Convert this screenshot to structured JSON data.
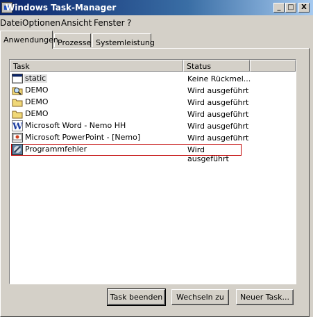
{
  "window": {
    "title": "Windows Task-Manager"
  },
  "titlebar_buttons": {
    "minimize": "_",
    "maximize": "□",
    "close": "X"
  },
  "menu": [
    "Datei",
    "Optionen",
    "Ansicht",
    "Fenster",
    "?"
  ],
  "tabs": [
    "Anwendungen",
    "Prozesse",
    "Systemleistung"
  ],
  "list": {
    "headers": {
      "task": "Task",
      "status": "Status"
    },
    "rows": [
      {
        "icon": "application-window-icon",
        "task": "static",
        "status": "Keine Rückmel..."
      },
      {
        "icon": "folder-search-icon",
        "task": "DEMO",
        "status": "Wird ausgeführt"
      },
      {
        "icon": "folder-icon",
        "task": "DEMO",
        "status": "Wird ausgeführt"
      },
      {
        "icon": "folder-icon",
        "task": "DEMO",
        "status": "Wird ausgeführt"
      },
      {
        "icon": "word-icon",
        "task": "Microsoft Word - Nemo HH",
        "status": "Wird ausgeführt"
      },
      {
        "icon": "powerpoint-icon",
        "task": "Microsoft PowerPoint - [Nemo]",
        "status": "Wird ausgeführt"
      },
      {
        "icon": "error-app-icon",
        "task": "Programmfehler",
        "status": "Wird ausgeführt"
      }
    ]
  },
  "buttons": {
    "end_task": "Task beenden",
    "switch_to": "Wechseln zu",
    "new_task": "Neuer Task..."
  }
}
